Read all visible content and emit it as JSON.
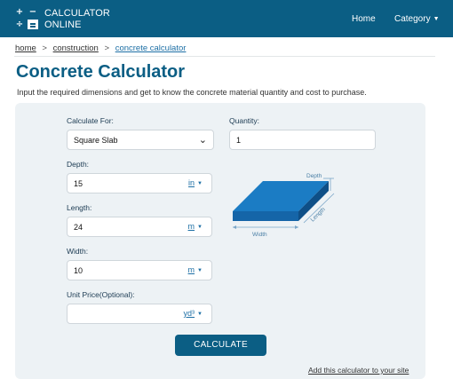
{
  "header": {
    "logo_symbols": [
      "+",
      "−",
      "÷",
      "="
    ],
    "brand_line1": "CALCULATOR",
    "brand_line2": "ONLINE",
    "nav_home": "Home",
    "nav_category": "Category",
    "category_caret": "▼"
  },
  "breadcrumb": {
    "items": [
      "home",
      "construction",
      "concrete calculator"
    ],
    "separator": ">"
  },
  "page": {
    "title": "Concrete Calculator",
    "subtitle": "Input the required dimensions and get to know the concrete material quantity and cost to purchase."
  },
  "form": {
    "calculate_for": {
      "label": "Calculate For:",
      "selected": "Square Slab"
    },
    "quantity": {
      "label": "Quantity:",
      "value": "1"
    },
    "depth": {
      "label": "Depth:",
      "value": "15",
      "unit": "in"
    },
    "length": {
      "label": "Length:",
      "value": "24",
      "unit": "m"
    },
    "width": {
      "label": "Width:",
      "value": "10",
      "unit": "m"
    },
    "unit_price": {
      "label": "Unit Price(Optional):",
      "value": "",
      "unit": "yd³"
    },
    "unit_caret": "▼",
    "calculate_button": "CALCULATE"
  },
  "figure": {
    "depth_label": "Depth",
    "length_label": "Length",
    "width_label": "Width"
  },
  "footer": {
    "add_link": "Add this calculator to your site"
  },
  "colors": {
    "brand": "#0b5e84",
    "link": "#1d6fa5",
    "card_background": "#edf2f5",
    "slab_front": "#1565a8",
    "slab_top": "#1b7cc4"
  },
  "icons": {
    "select_chevron": "chevron-down-icon",
    "unit_dropdown": "caret-down-icon"
  }
}
